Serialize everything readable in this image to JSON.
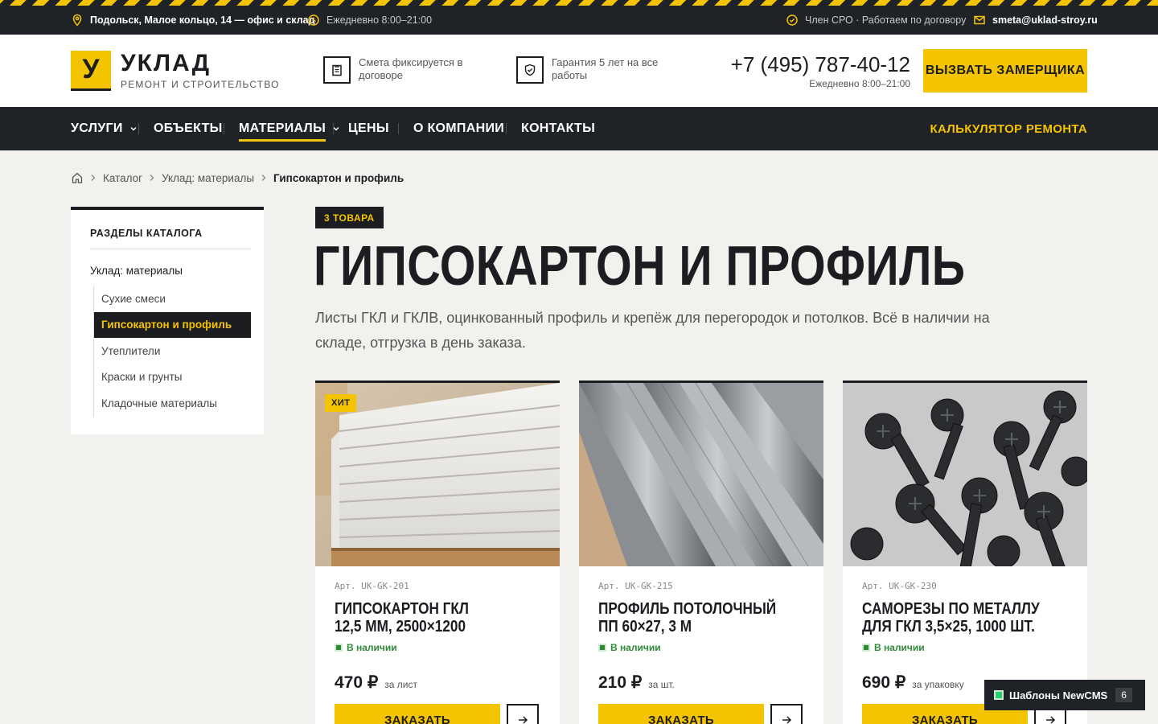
{
  "topbar": {
    "address": "Подольск, Малое кольцо, 14 — офис и склад",
    "hours": "Ежедневно 8:00–21:00",
    "sro": "Член СРО · Работаем по договору",
    "email": "smeta@uklad-stroy.ru"
  },
  "header": {
    "logo_letter": "У",
    "logo_name": "УКЛАД",
    "logo_sub": "РЕМОНТ И СТРОИТЕЛЬСТВО",
    "feature1": "Смета фиксируется в договоре",
    "feature2": "Гарантия 5 лет на все работы",
    "phone": "+7 (495) 787-40-12",
    "phone_hours": "Ежедневно 8:00–21:00",
    "cta": "ВЫЗВАТЬ ЗАМЕРЩИКА"
  },
  "nav": {
    "items": [
      "УСЛУГИ",
      "ОБЪЕКТЫ",
      "МАТЕРИАЛЫ",
      "ЦЕНЫ",
      "О КОМПАНИИ",
      "КОНТАКТЫ"
    ],
    "calculator": "КАЛЬКУЛЯТОР РЕМОНТА"
  },
  "breadcrumb": {
    "items": [
      "Каталог",
      "Уклад: материалы"
    ],
    "current": "Гипсокартон и профиль"
  },
  "sidebar": {
    "title": "РАЗДЕЛЫ КАТАЛОГА",
    "parent": "Уклад: материалы",
    "items": [
      "Сухие смеси",
      "Гипсокартон и профиль",
      "Утеплители",
      "Краски и грунты",
      "Кладочные материалы"
    ],
    "active_index": 1
  },
  "main": {
    "badge": "3 ТОВАРА",
    "title": "ГИПСОКАРТОН И ПРОФИЛЬ",
    "lead": "Листы ГКЛ и ГКЛВ, оцинкованный профиль и крепёж для перегородок и потолков. Всё в наличии на складе, отгрузка в день заказа."
  },
  "products": [
    {
      "hit": "ХИТ",
      "art": "Арт. UK-GK-201",
      "title_line1": "ГИПСОКАРТОН ГКЛ",
      "title_line2": "12,5 ММ, 2500×1200",
      "stock": "В наличии",
      "price": "470 ₽",
      "unit": "за лист",
      "order": "ЗАКАЗАТЬ"
    },
    {
      "art": "Арт. UK-GK-215",
      "title_line1": "ПРОФИЛЬ ПОТОЛОЧНЫЙ",
      "title_line2": "ПП 60×27, 3 М",
      "stock": "В наличии",
      "price": "210 ₽",
      "unit": "за шт.",
      "order": "ЗАКАЗАТЬ"
    },
    {
      "art": "Арт. UK-GK-230",
      "title_line1": "САМОРЕЗЫ ПО МЕТАЛЛУ",
      "title_line2": "ДЛЯ ГКЛ 3,5×25, 1000 ШТ.",
      "stock": "В наличии",
      "price": "690 ₽",
      "unit": "за упаковку",
      "order": "ЗАКАЗАТЬ"
    }
  ],
  "widget": {
    "label": "Шаблоны NewCMS",
    "count": "6"
  },
  "colors": {
    "accent": "#f5c400",
    "dark": "#1f2227",
    "stock_green": "#2e8b3a"
  }
}
